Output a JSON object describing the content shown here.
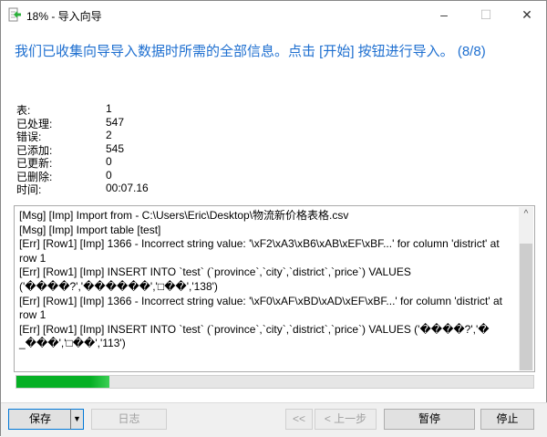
{
  "window": {
    "title": "18% - 导入向导",
    "minimize": "–",
    "maximize": "☐",
    "close": "✕"
  },
  "heading": "我们已收集向导导入数据时所需的全部信息。点击 [开始] 按钮进行导入。 (8/8)",
  "stats": [
    {
      "label": "表:",
      "value": "1"
    },
    {
      "label": "已处理:",
      "value": "547"
    },
    {
      "label": "错误:",
      "value": "2"
    },
    {
      "label": "已添加:",
      "value": "545"
    },
    {
      "label": "已更新:",
      "value": "0"
    },
    {
      "label": "已删除:",
      "value": "0"
    },
    {
      "label": "时间:",
      "value": "00:07.16"
    }
  ],
  "log": "[Msg] [Imp] Import from - C:\\Users\\Eric\\Desktop\\物流新价格表格.csv\n[Msg] [Imp] Import table [test]\n[Err] [Row1] [Imp] 1366 - Incorrect string value: '\\xF2\\xA3\\xB6\\xAB\\xEF\\xBF...' for column 'district' at row 1\n[Err] [Row1] [Imp] INSERT INTO `test` (`province`,`city`,`district`,`price`) VALUES ('����?','������','□��','138')\n[Err] [Row1] [Imp] 1366 - Incorrect string value: '\\xF0\\xAF\\xBD\\xAD\\xEF\\xBF...' for column 'district' at row 1\n[Err] [Row1] [Imp] INSERT INTO `test` (`province`,`city`,`district`,`price`) VALUES ('����?','�\n_���','□��','113')",
  "progress_percent": 18,
  "buttons": {
    "save": "保存",
    "save_dropdown": "▼",
    "log": "日志",
    "first": "<<",
    "prev": "< 上一步",
    "pause": "暂停",
    "stop": "停止"
  },
  "colors": {
    "heading": "#1e6fd0",
    "progress": "#06b025"
  }
}
